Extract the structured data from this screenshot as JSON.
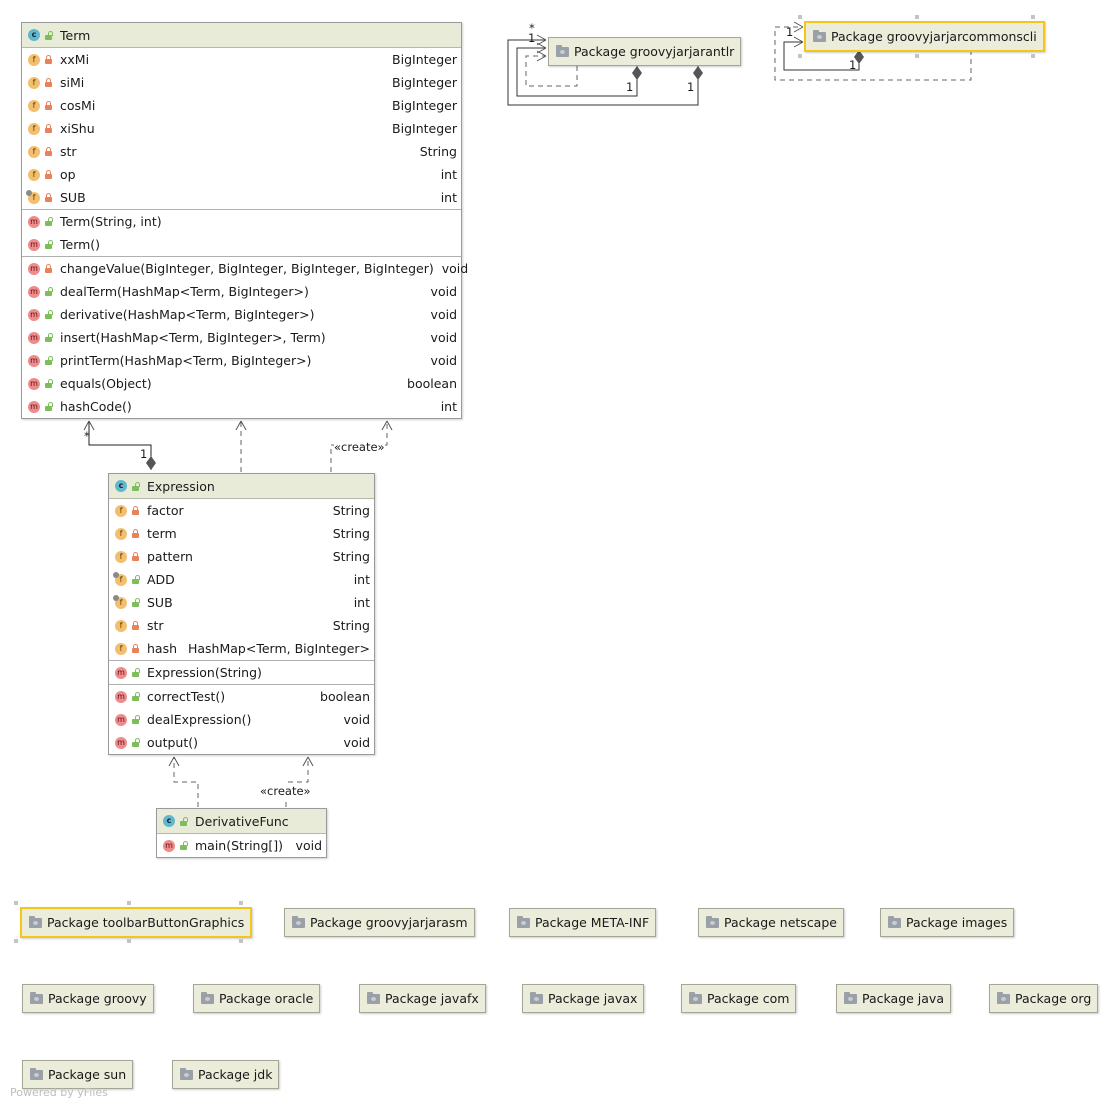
{
  "classes": {
    "term": {
      "name": "Term",
      "fields": [
        {
          "name": "xxMi",
          "type": "BigInteger"
        },
        {
          "name": "siMi",
          "type": "BigInteger"
        },
        {
          "name": "cosMi",
          "type": "BigInteger"
        },
        {
          "name": "xiShu",
          "type": "BigInteger"
        },
        {
          "name": "str",
          "type": "String"
        },
        {
          "name": "op",
          "type": "int"
        },
        {
          "name": "SUB",
          "type": "int"
        }
      ],
      "constructors": [
        {
          "name": "Term(String, int)"
        },
        {
          "name": "Term()"
        }
      ],
      "methods": [
        {
          "name": "changeValue(BigInteger, BigInteger, BigInteger, BigInteger)",
          "type": "void"
        },
        {
          "name": "dealTerm(HashMap<Term, BigInteger>)",
          "type": "void"
        },
        {
          "name": "derivative(HashMap<Term, BigInteger>)",
          "type": "void"
        },
        {
          "name": "insert(HashMap<Term, BigInteger>, Term)",
          "type": "void"
        },
        {
          "name": "printTerm(HashMap<Term, BigInteger>)",
          "type": "void"
        },
        {
          "name": "equals(Object)",
          "type": "boolean"
        },
        {
          "name": "hashCode()",
          "type": "int"
        }
      ]
    },
    "expression": {
      "name": "Expression",
      "fields": [
        {
          "name": "factor",
          "type": "String"
        },
        {
          "name": "term",
          "type": "String"
        },
        {
          "name": "pattern",
          "type": "String"
        },
        {
          "name": "ADD",
          "type": "int"
        },
        {
          "name": "SUB",
          "type": "int"
        },
        {
          "name": "str",
          "type": "String"
        },
        {
          "name": "hash",
          "type": "HashMap<Term, BigInteger>"
        }
      ],
      "constructors": [
        {
          "name": "Expression(String)"
        }
      ],
      "methods": [
        {
          "name": "correctTest()",
          "type": "boolean"
        },
        {
          "name": "dealExpression()",
          "type": "void"
        },
        {
          "name": "output()",
          "type": "void"
        }
      ]
    },
    "derivative": {
      "name": "DerivativeFunc",
      "methods": [
        {
          "name": "main(String[])",
          "type": "void"
        }
      ]
    }
  },
  "packages": {
    "antlr": "Package groovyjarjarantlr",
    "commonscli": "Package groovyjarjarcommonscli",
    "toolbar": "Package toolbarButtonGraphics",
    "asm": "Package groovyjarjarasm",
    "metainf": "Package META-INF",
    "netscape": "Package netscape",
    "images": "Package images",
    "groovy": "Package groovy",
    "oracle": "Package oracle",
    "javafx": "Package javafx",
    "javax": "Package javax",
    "com": "Package com",
    "java": "Package java",
    "org": "Package org",
    "sun": "Package sun",
    "jdk": "Package jdk"
  },
  "edge_labels": {
    "term_star": "*",
    "term_one": "1",
    "create1": "«create»",
    "create2": "«create»",
    "antlr_star": "*",
    "antlr_one_a": "1",
    "antlr_one_b": "1",
    "antlr_one_c": "1",
    "cli_one_a": "1",
    "cli_one_b": "1"
  },
  "footer": "Powered by yFiles",
  "colors": {
    "header": "#e9ebd9",
    "selection": "#f5c518",
    "class_badge": "#62b7cc",
    "field_badge": "#f3bf6e",
    "method_badge": "#ef8b8b"
  }
}
